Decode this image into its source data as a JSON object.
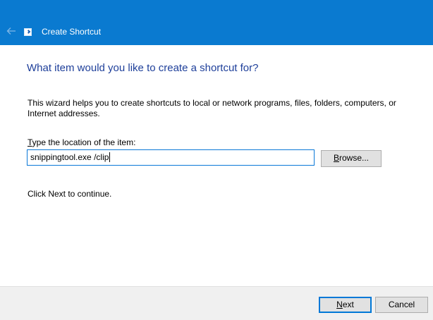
{
  "window": {
    "title": "Create Shortcut",
    "back_icon": "back-arrow-icon",
    "app_icon": "shortcut-icon",
    "colors": {
      "titlebar": "#0a7ad0",
      "heading": "#1e3f9a",
      "focus": "#0078d7"
    }
  },
  "main": {
    "heading": "What item would you like to create a shortcut for?",
    "description": "This wizard helps you to create shortcuts to local or network programs, files, folders, computers, or Internet addresses.",
    "location_label_prefix": "T",
    "location_label_rest": "ype the location of the item:",
    "location_value": "snippingtool.exe /clip",
    "browse_label": "Browse...",
    "continue_text": "Click Next to continue."
  },
  "footer": {
    "next_label": "Next",
    "cancel_label": "Cancel"
  }
}
